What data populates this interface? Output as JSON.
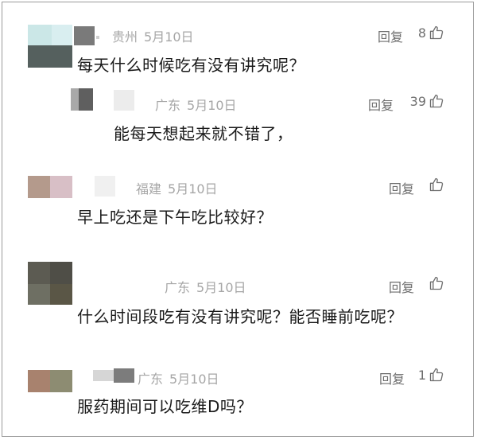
{
  "comments": [
    {
      "location": "贵州",
      "date": "5月10日",
      "reply_label": "回复",
      "likes": "8",
      "content": "每天什么时候吃有没有讲究呢？"
    },
    {
      "location": "广东",
      "date": "5月10日",
      "reply_label": "回复",
      "likes": "39",
      "content": "能每天想起来就不错了，"
    },
    {
      "location": "福建",
      "date": "5月10日",
      "reply_label": "回复",
      "likes": "",
      "content": "早上吃还是下午吃比较好？"
    },
    {
      "location": "广东",
      "date": "5月10日",
      "reply_label": "回复",
      "likes": "",
      "content": "什么时间段吃有没有讲究呢？能否睡前吃呢？"
    },
    {
      "location": "广东",
      "date": "5月10日",
      "reply_label": "回复",
      "likes": "1",
      "content": "服药期间可以吃维D吗？"
    }
  ],
  "colors": {
    "meta_text": "#a6a6a6",
    "action_text": "#6e6e6e",
    "content_text": "#1a1a1a"
  },
  "icons": {
    "like": "thumbs-up-icon",
    "avatar": "pixelated-avatar"
  }
}
